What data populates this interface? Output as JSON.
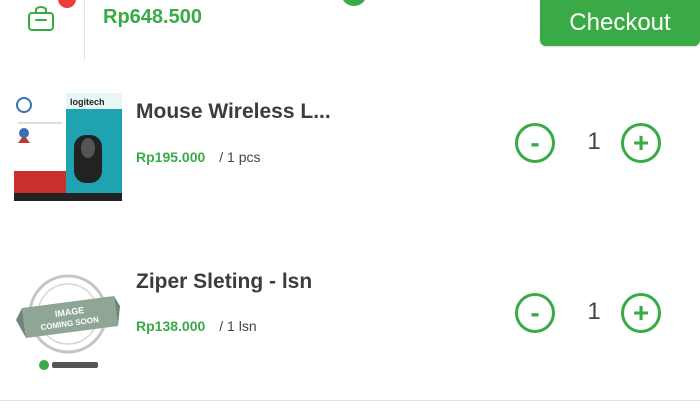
{
  "header": {
    "total_price": "Rp648.500",
    "checkout_label": "Checkout"
  },
  "cart": {
    "items": [
      {
        "name": "Mouse Wireless L...",
        "price": "Rp195.000",
        "unit": "/ 1 pcs",
        "quantity": "1",
        "image": "logitech-mouse-product-image",
        "minus_label": "-",
        "plus_label": "+"
      },
      {
        "name": "Ziper Sleting - lsn",
        "price": "Rp138.000",
        "unit": "/ 1 lsn",
        "quantity": "1",
        "image": "image-coming-soon-placeholder",
        "minus_label": "-",
        "plus_label": "+"
      }
    ]
  },
  "colors": {
    "accent_green": "#3aaa47",
    "badge_red": "#ef3b3b"
  },
  "icons": {
    "cart": "shopping-bag-icon"
  }
}
